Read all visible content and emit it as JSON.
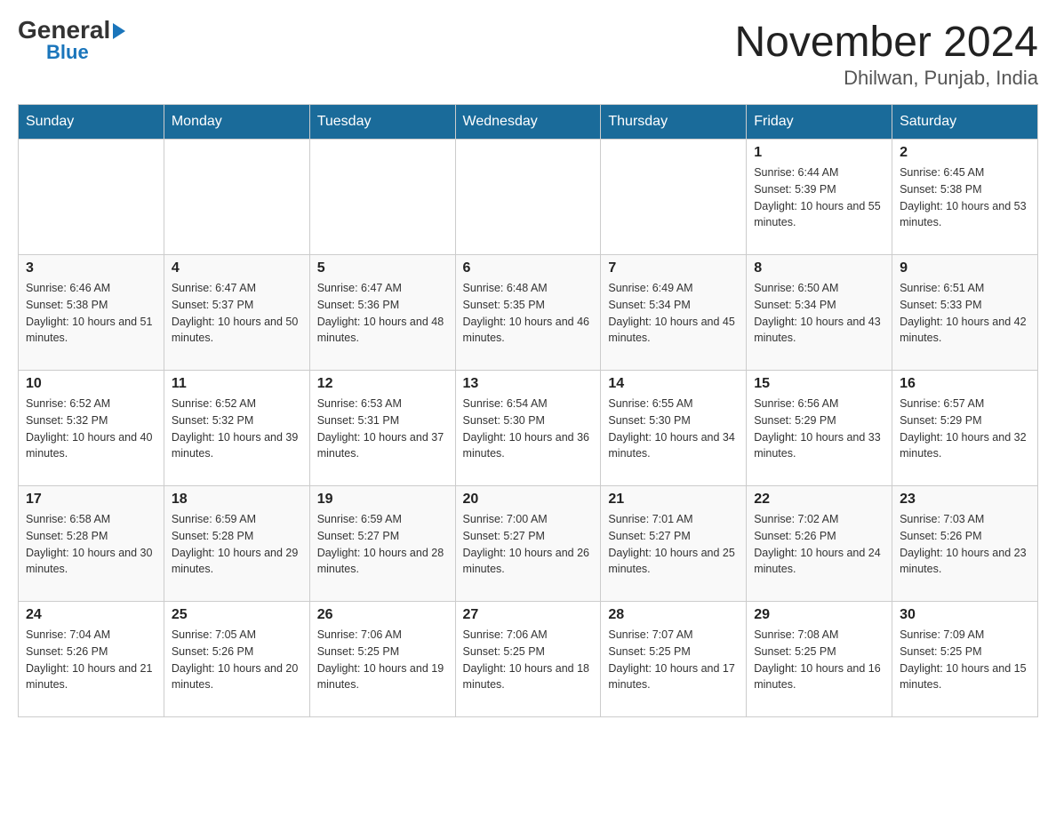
{
  "header": {
    "logo_general": "General",
    "logo_blue": "Blue",
    "title": "November 2024",
    "subtitle": "Dhilwan, Punjab, India"
  },
  "days_of_week": [
    "Sunday",
    "Monday",
    "Tuesday",
    "Wednesday",
    "Thursday",
    "Friday",
    "Saturday"
  ],
  "weeks": [
    [
      {
        "day": "",
        "info": ""
      },
      {
        "day": "",
        "info": ""
      },
      {
        "day": "",
        "info": ""
      },
      {
        "day": "",
        "info": ""
      },
      {
        "day": "",
        "info": ""
      },
      {
        "day": "1",
        "info": "Sunrise: 6:44 AM\nSunset: 5:39 PM\nDaylight: 10 hours and 55 minutes."
      },
      {
        "day": "2",
        "info": "Sunrise: 6:45 AM\nSunset: 5:38 PM\nDaylight: 10 hours and 53 minutes."
      }
    ],
    [
      {
        "day": "3",
        "info": "Sunrise: 6:46 AM\nSunset: 5:38 PM\nDaylight: 10 hours and 51 minutes."
      },
      {
        "day": "4",
        "info": "Sunrise: 6:47 AM\nSunset: 5:37 PM\nDaylight: 10 hours and 50 minutes."
      },
      {
        "day": "5",
        "info": "Sunrise: 6:47 AM\nSunset: 5:36 PM\nDaylight: 10 hours and 48 minutes."
      },
      {
        "day": "6",
        "info": "Sunrise: 6:48 AM\nSunset: 5:35 PM\nDaylight: 10 hours and 46 minutes."
      },
      {
        "day": "7",
        "info": "Sunrise: 6:49 AM\nSunset: 5:34 PM\nDaylight: 10 hours and 45 minutes."
      },
      {
        "day": "8",
        "info": "Sunrise: 6:50 AM\nSunset: 5:34 PM\nDaylight: 10 hours and 43 minutes."
      },
      {
        "day": "9",
        "info": "Sunrise: 6:51 AM\nSunset: 5:33 PM\nDaylight: 10 hours and 42 minutes."
      }
    ],
    [
      {
        "day": "10",
        "info": "Sunrise: 6:52 AM\nSunset: 5:32 PM\nDaylight: 10 hours and 40 minutes."
      },
      {
        "day": "11",
        "info": "Sunrise: 6:52 AM\nSunset: 5:32 PM\nDaylight: 10 hours and 39 minutes."
      },
      {
        "day": "12",
        "info": "Sunrise: 6:53 AM\nSunset: 5:31 PM\nDaylight: 10 hours and 37 minutes."
      },
      {
        "day": "13",
        "info": "Sunrise: 6:54 AM\nSunset: 5:30 PM\nDaylight: 10 hours and 36 minutes."
      },
      {
        "day": "14",
        "info": "Sunrise: 6:55 AM\nSunset: 5:30 PM\nDaylight: 10 hours and 34 minutes."
      },
      {
        "day": "15",
        "info": "Sunrise: 6:56 AM\nSunset: 5:29 PM\nDaylight: 10 hours and 33 minutes."
      },
      {
        "day": "16",
        "info": "Sunrise: 6:57 AM\nSunset: 5:29 PM\nDaylight: 10 hours and 32 minutes."
      }
    ],
    [
      {
        "day": "17",
        "info": "Sunrise: 6:58 AM\nSunset: 5:28 PM\nDaylight: 10 hours and 30 minutes."
      },
      {
        "day": "18",
        "info": "Sunrise: 6:59 AM\nSunset: 5:28 PM\nDaylight: 10 hours and 29 minutes."
      },
      {
        "day": "19",
        "info": "Sunrise: 6:59 AM\nSunset: 5:27 PM\nDaylight: 10 hours and 28 minutes."
      },
      {
        "day": "20",
        "info": "Sunrise: 7:00 AM\nSunset: 5:27 PM\nDaylight: 10 hours and 26 minutes."
      },
      {
        "day": "21",
        "info": "Sunrise: 7:01 AM\nSunset: 5:27 PM\nDaylight: 10 hours and 25 minutes."
      },
      {
        "day": "22",
        "info": "Sunrise: 7:02 AM\nSunset: 5:26 PM\nDaylight: 10 hours and 24 minutes."
      },
      {
        "day": "23",
        "info": "Sunrise: 7:03 AM\nSunset: 5:26 PM\nDaylight: 10 hours and 23 minutes."
      }
    ],
    [
      {
        "day": "24",
        "info": "Sunrise: 7:04 AM\nSunset: 5:26 PM\nDaylight: 10 hours and 21 minutes."
      },
      {
        "day": "25",
        "info": "Sunrise: 7:05 AM\nSunset: 5:26 PM\nDaylight: 10 hours and 20 minutes."
      },
      {
        "day": "26",
        "info": "Sunrise: 7:06 AM\nSunset: 5:25 PM\nDaylight: 10 hours and 19 minutes."
      },
      {
        "day": "27",
        "info": "Sunrise: 7:06 AM\nSunset: 5:25 PM\nDaylight: 10 hours and 18 minutes."
      },
      {
        "day": "28",
        "info": "Sunrise: 7:07 AM\nSunset: 5:25 PM\nDaylight: 10 hours and 17 minutes."
      },
      {
        "day": "29",
        "info": "Sunrise: 7:08 AM\nSunset: 5:25 PM\nDaylight: 10 hours and 16 minutes."
      },
      {
        "day": "30",
        "info": "Sunrise: 7:09 AM\nSunset: 5:25 PM\nDaylight: 10 hours and 15 minutes."
      }
    ]
  ]
}
